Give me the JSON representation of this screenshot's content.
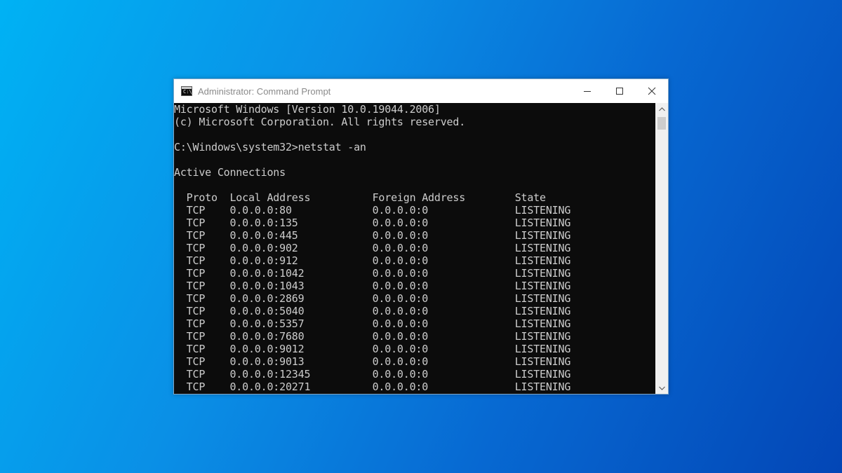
{
  "window": {
    "title": "Administrator: Command Prompt",
    "icon_label": "C:\\_",
    "controls": {
      "minimize": "minimize-icon",
      "maximize": "maximize-icon",
      "close": "close-icon"
    }
  },
  "console": {
    "lines": [
      "Microsoft Windows [Version 10.0.19044.2006]",
      "(c) Microsoft Corporation. All rights reserved.",
      "",
      "C:\\Windows\\system32>netstat -an",
      "",
      "Active Connections",
      "",
      "  Proto  Local Address          Foreign Address        State",
      "  TCP    0.0.0.0:80             0.0.0.0:0              LISTENING",
      "  TCP    0.0.0.0:135            0.0.0.0:0              LISTENING",
      "  TCP    0.0.0.0:445            0.0.0.0:0              LISTENING",
      "  TCP    0.0.0.0:902            0.0.0.0:0              LISTENING",
      "  TCP    0.0.0.0:912            0.0.0.0:0              LISTENING",
      "  TCP    0.0.0.0:1042           0.0.0.0:0              LISTENING",
      "  TCP    0.0.0.0:1043           0.0.0.0:0              LISTENING",
      "  TCP    0.0.0.0:2869           0.0.0.0:0              LISTENING",
      "  TCP    0.0.0.0:5040           0.0.0.0:0              LISTENING",
      "  TCP    0.0.0.0:5357           0.0.0.0:0              LISTENING",
      "  TCP    0.0.0.0:7680           0.0.0.0:0              LISTENING",
      "  TCP    0.0.0.0:9012           0.0.0.0:0              LISTENING",
      "  TCP    0.0.0.0:9013           0.0.0.0:0              LISTENING",
      "  TCP    0.0.0.0:12345          0.0.0.0:0              LISTENING",
      "  TCP    0.0.0.0:20271          0.0.0.0:0              LISTENING"
    ]
  },
  "scrollbar": {
    "up_icon": "scroll-up-arrow-icon",
    "down_icon": "scroll-down-arrow-icon"
  },
  "colors": {
    "console_bg": "#0c0c0c",
    "console_text": "#cccccc",
    "desktop_gradient_start": "#00b2f4",
    "desktop_gradient_end": "#0346b6"
  }
}
